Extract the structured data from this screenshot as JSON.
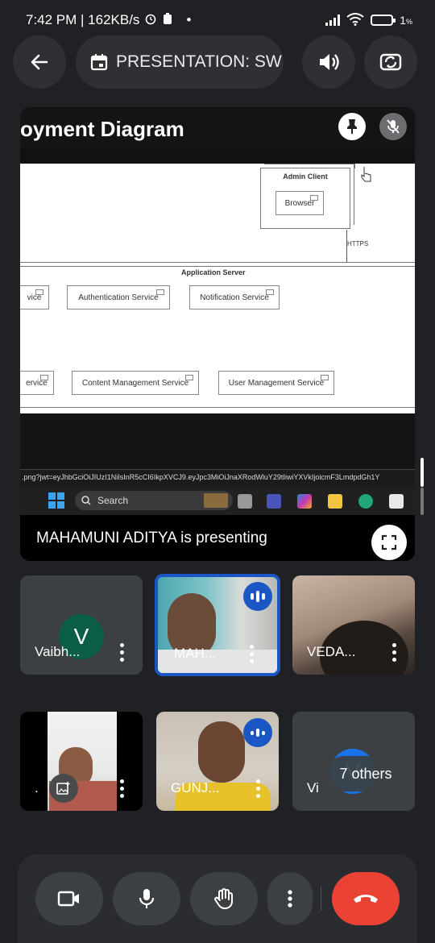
{
  "status_bar": {
    "time_info": "7:42 PM | 162KB/s",
    "dot": "•",
    "battery": "1",
    "battery_unit": "%"
  },
  "top_bar": {
    "back_icon": "arrow-left-icon",
    "meeting_title": "PRESENTATION: SW",
    "calendar_icon": "calendar-icon",
    "speaker_icon": "speaker-icon",
    "switch_camera_icon": "switch-camera-icon"
  },
  "presentation": {
    "slide_title": "oyment Diagram",
    "diagram": {
      "admin_client": "Admin Client",
      "browser": "Browser",
      "https": "HTTPS",
      "app_server": "Application Server",
      "row1": [
        "vice",
        "Authentication Service",
        "Notification Service"
      ],
      "row2": [
        "ervice",
        "Content Management Service",
        "User Management Service"
      ]
    },
    "url_text": ".png?jwt=eyJhbGciOiJIUzI1NiIsInR5cCI6IkpXVCJ9.eyJpc3MiOiJnaXRodWluY29tIiwiYXVkIjoicmF3LmdpdGh1Y",
    "taskbar_search": "Search",
    "presenter_text": "MAHAMUNI ADITYA is presenting",
    "pin_icon": "pin-icon",
    "muted_icon": "mic-off-icon",
    "fullscreen_icon": "fullscreen-icon"
  },
  "participants": [
    {
      "name": "Vaibh...",
      "initial": "V",
      "avatar_color": "#0b5e48"
    },
    {
      "name": "MAH...",
      "speaking": true
    },
    {
      "name": "VEDA..."
    },
    {
      "name": "."
    },
    {
      "name": "GUNJ...",
      "speaking": true
    },
    {
      "name": "Vi",
      "initial": "V",
      "avatar_color": "#1a73e8",
      "others": "7 others"
    }
  ],
  "controls": {
    "camera_icon": "video-camera-icon",
    "mic_icon": "microphone-icon",
    "hand_icon": "raise-hand-icon",
    "more_icon": "more-vertical-icon",
    "end_call_icon": "end-call-icon"
  },
  "colors": {
    "end_call": "#ea4335",
    "speaking": "#1a56c4",
    "active_tile_border": "#1a56c4"
  }
}
